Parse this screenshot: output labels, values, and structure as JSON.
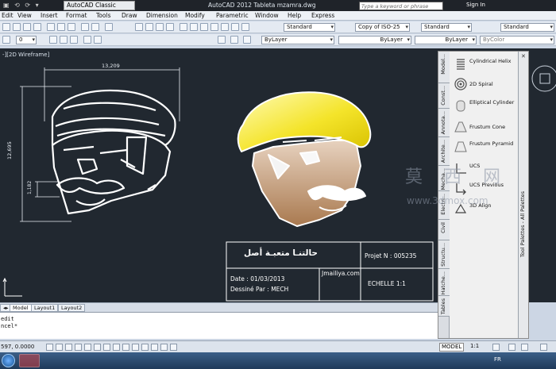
{
  "app": {
    "workspace": "AutoCAD Classic",
    "title": "AutoCAD 2012   Tableta mzamra.dwg",
    "search_placeholder": "Type a keyword or phrase",
    "sign_in": "Sign In"
  },
  "menu": [
    "Edit",
    "View",
    "Insert",
    "Format",
    "Tools",
    "Draw",
    "Dimension",
    "Modify",
    "Parametric",
    "Window",
    "Help",
    "Express"
  ],
  "toolbar": {
    "text_style": "Standard",
    "dim_style": "Copy of ISO-25",
    "table_style": "Standard",
    "multileader_style": "Standard",
    "layer_color": "ByLayer",
    "layer_linetype": "ByLayer",
    "layer_lineweight": "ByLayer",
    "plot_style": "ByColor",
    "layer_zero": "0"
  },
  "viewport": {
    "label": "-][2D Wireframe]"
  },
  "drawing": {
    "dim_top": "13,209",
    "dim_left": "12,695",
    "dim_small": "1,182",
    "title_block": {
      "arabic_title": "حالتنـا متعبـة أصل",
      "project": "Projet N : 005235",
      "date": "Date : 01/03/2013",
      "designer": "Dessiné Par : MECH",
      "website": "Jmailiya.com",
      "scale": "ECHELLE 1:1"
    }
  },
  "palette": {
    "title": "Tool Palettes - All Palettes",
    "tabs": [
      "Model...",
      "Const...",
      "Annota...",
      "Archite...",
      "Mecha...",
      "Electri...",
      "Civil",
      "Structu...",
      "Hatche...",
      "Tables"
    ],
    "items": [
      {
        "label": "Cylindrical Helix"
      },
      {
        "label": "2D Spiral"
      },
      {
        "label": "Elliptical Cylinder"
      },
      {
        "label": "Frustum Cone"
      },
      {
        "label": "Frustum Pyramid"
      },
      {
        "label": "UCS"
      },
      {
        "label": "UCS Previous"
      },
      {
        "label": "3D Align"
      }
    ]
  },
  "layout_tabs": [
    "Model",
    "Layout1",
    "Layout2"
  ],
  "command_lines": [
    "edit",
    "ncel*"
  ],
  "status": {
    "coords": "597, 0.0000",
    "model": "MODEL",
    "scale": "1:1"
  },
  "taskbar": {
    "lang": "FR"
  },
  "watermark": {
    "text": "莫 西 网",
    "url": "www.3dmox.com"
  }
}
